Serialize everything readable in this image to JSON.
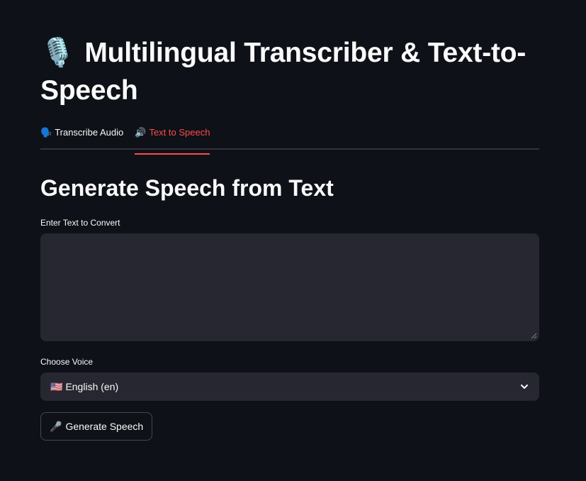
{
  "header": {
    "title_icon": "microphone-icon",
    "title_icon_glyph": "🎙️",
    "title": "Multilingual Transcriber & Text-to-Speech"
  },
  "tabs": [
    {
      "icon": "speaking-head-icon",
      "glyph": "🗣️",
      "label": "Transcribe Audio",
      "active": false
    },
    {
      "icon": "speaker-icon",
      "glyph": "🔊",
      "label": "Text to Speech",
      "active": true
    }
  ],
  "main": {
    "heading": "Generate Speech from Text",
    "text_input": {
      "label": "Enter Text to Convert",
      "value": ""
    },
    "voice_select": {
      "label": "Choose Voice",
      "flag_icon": "us-flag-icon",
      "flag_glyph": "🇺🇸",
      "value": "English (en)"
    },
    "generate_button": {
      "icon": "microphone-icon",
      "glyph": "🎤",
      "label": "Generate Speech"
    }
  },
  "colors": {
    "background": "#0e1117",
    "accent": "#ff4b4b",
    "input_bg": "#262730",
    "text": "#fafafa"
  }
}
